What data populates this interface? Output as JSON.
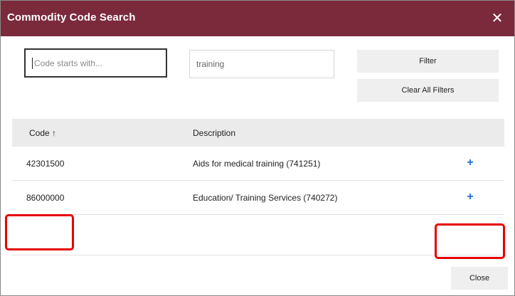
{
  "dialog": {
    "title": "Commodity Code Search",
    "close_glyph": "✕",
    "title_bar_color": "#7b2a3c"
  },
  "filters": {
    "code_placeholder": "Code starts with...",
    "description_value": "training",
    "filter_label": "Filter",
    "clear_label": "Clear All Filters"
  },
  "table": {
    "headers": {
      "code": "Code ↑",
      "description": "Description"
    },
    "rows": [
      {
        "code": "42301500",
        "description": "Aids for medical training (741251)",
        "add_icon": "plus-icon"
      },
      {
        "code": "86000000",
        "description": "Education/ Training Services (740272)",
        "add_icon": "plus-icon"
      }
    ],
    "add_glyph": "+"
  },
  "footer": {
    "close_label": "Close"
  },
  "annotations": {
    "highlight_color": "#e60000"
  }
}
